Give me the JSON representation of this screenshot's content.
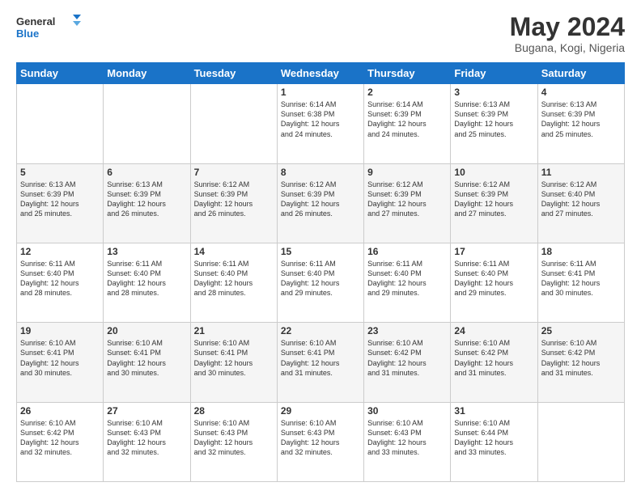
{
  "logo": {
    "line1": "General",
    "line2": "Blue"
  },
  "title": "May 2024",
  "location": "Bugana, Kogi, Nigeria",
  "weekdays": [
    "Sunday",
    "Monday",
    "Tuesday",
    "Wednesday",
    "Thursday",
    "Friday",
    "Saturday"
  ],
  "weeks": [
    [
      {
        "num": "",
        "info": ""
      },
      {
        "num": "",
        "info": ""
      },
      {
        "num": "",
        "info": ""
      },
      {
        "num": "1",
        "info": "Sunrise: 6:14 AM\nSunset: 6:38 PM\nDaylight: 12 hours\nand 24 minutes."
      },
      {
        "num": "2",
        "info": "Sunrise: 6:14 AM\nSunset: 6:39 PM\nDaylight: 12 hours\nand 24 minutes."
      },
      {
        "num": "3",
        "info": "Sunrise: 6:13 AM\nSunset: 6:39 PM\nDaylight: 12 hours\nand 25 minutes."
      },
      {
        "num": "4",
        "info": "Sunrise: 6:13 AM\nSunset: 6:39 PM\nDaylight: 12 hours\nand 25 minutes."
      }
    ],
    [
      {
        "num": "5",
        "info": "Sunrise: 6:13 AM\nSunset: 6:39 PM\nDaylight: 12 hours\nand 25 minutes."
      },
      {
        "num": "6",
        "info": "Sunrise: 6:13 AM\nSunset: 6:39 PM\nDaylight: 12 hours\nand 26 minutes."
      },
      {
        "num": "7",
        "info": "Sunrise: 6:12 AM\nSunset: 6:39 PM\nDaylight: 12 hours\nand 26 minutes."
      },
      {
        "num": "8",
        "info": "Sunrise: 6:12 AM\nSunset: 6:39 PM\nDaylight: 12 hours\nand 26 minutes."
      },
      {
        "num": "9",
        "info": "Sunrise: 6:12 AM\nSunset: 6:39 PM\nDaylight: 12 hours\nand 27 minutes."
      },
      {
        "num": "10",
        "info": "Sunrise: 6:12 AM\nSunset: 6:39 PM\nDaylight: 12 hours\nand 27 minutes."
      },
      {
        "num": "11",
        "info": "Sunrise: 6:12 AM\nSunset: 6:40 PM\nDaylight: 12 hours\nand 27 minutes."
      }
    ],
    [
      {
        "num": "12",
        "info": "Sunrise: 6:11 AM\nSunset: 6:40 PM\nDaylight: 12 hours\nand 28 minutes."
      },
      {
        "num": "13",
        "info": "Sunrise: 6:11 AM\nSunset: 6:40 PM\nDaylight: 12 hours\nand 28 minutes."
      },
      {
        "num": "14",
        "info": "Sunrise: 6:11 AM\nSunset: 6:40 PM\nDaylight: 12 hours\nand 28 minutes."
      },
      {
        "num": "15",
        "info": "Sunrise: 6:11 AM\nSunset: 6:40 PM\nDaylight: 12 hours\nand 29 minutes."
      },
      {
        "num": "16",
        "info": "Sunrise: 6:11 AM\nSunset: 6:40 PM\nDaylight: 12 hours\nand 29 minutes."
      },
      {
        "num": "17",
        "info": "Sunrise: 6:11 AM\nSunset: 6:40 PM\nDaylight: 12 hours\nand 29 minutes."
      },
      {
        "num": "18",
        "info": "Sunrise: 6:11 AM\nSunset: 6:41 PM\nDaylight: 12 hours\nand 30 minutes."
      }
    ],
    [
      {
        "num": "19",
        "info": "Sunrise: 6:10 AM\nSunset: 6:41 PM\nDaylight: 12 hours\nand 30 minutes."
      },
      {
        "num": "20",
        "info": "Sunrise: 6:10 AM\nSunset: 6:41 PM\nDaylight: 12 hours\nand 30 minutes."
      },
      {
        "num": "21",
        "info": "Sunrise: 6:10 AM\nSunset: 6:41 PM\nDaylight: 12 hours\nand 30 minutes."
      },
      {
        "num": "22",
        "info": "Sunrise: 6:10 AM\nSunset: 6:41 PM\nDaylight: 12 hours\nand 31 minutes."
      },
      {
        "num": "23",
        "info": "Sunrise: 6:10 AM\nSunset: 6:42 PM\nDaylight: 12 hours\nand 31 minutes."
      },
      {
        "num": "24",
        "info": "Sunrise: 6:10 AM\nSunset: 6:42 PM\nDaylight: 12 hours\nand 31 minutes."
      },
      {
        "num": "25",
        "info": "Sunrise: 6:10 AM\nSunset: 6:42 PM\nDaylight: 12 hours\nand 31 minutes."
      }
    ],
    [
      {
        "num": "26",
        "info": "Sunrise: 6:10 AM\nSunset: 6:42 PM\nDaylight: 12 hours\nand 32 minutes."
      },
      {
        "num": "27",
        "info": "Sunrise: 6:10 AM\nSunset: 6:43 PM\nDaylight: 12 hours\nand 32 minutes."
      },
      {
        "num": "28",
        "info": "Sunrise: 6:10 AM\nSunset: 6:43 PM\nDaylight: 12 hours\nand 32 minutes."
      },
      {
        "num": "29",
        "info": "Sunrise: 6:10 AM\nSunset: 6:43 PM\nDaylight: 12 hours\nand 32 minutes."
      },
      {
        "num": "30",
        "info": "Sunrise: 6:10 AM\nSunset: 6:43 PM\nDaylight: 12 hours\nand 33 minutes."
      },
      {
        "num": "31",
        "info": "Sunrise: 6:10 AM\nSunset: 6:44 PM\nDaylight: 12 hours\nand 33 minutes."
      },
      {
        "num": "",
        "info": ""
      }
    ]
  ]
}
